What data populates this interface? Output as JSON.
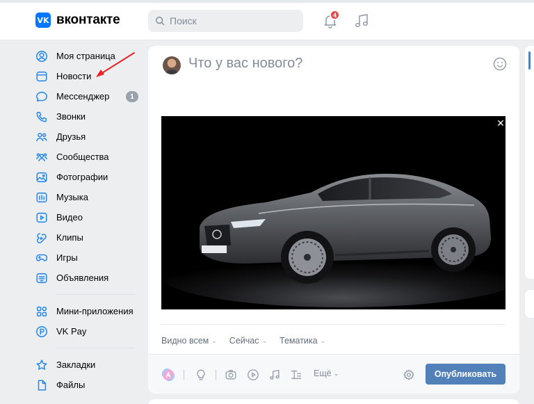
{
  "header": {
    "logo_mark": "VK",
    "logo_text": "вконтакте",
    "search_placeholder": "Поиск",
    "notifications_count": "4",
    "colors": {
      "brand": "#0077ff",
      "badge": "#e64646"
    }
  },
  "sidebar": {
    "items": [
      {
        "label": "Моя страница",
        "icon": "user-circle-icon"
      },
      {
        "label": "Новости",
        "icon": "news-icon"
      },
      {
        "label": "Мессенджер",
        "icon": "message-icon",
        "badge": "1"
      },
      {
        "label": "Звонки",
        "icon": "phone-icon"
      },
      {
        "label": "Друзья",
        "icon": "friends-icon"
      },
      {
        "label": "Сообщества",
        "icon": "communities-icon"
      },
      {
        "label": "Фотографии",
        "icon": "photo-icon"
      },
      {
        "label": "Музыка",
        "icon": "music-icon"
      },
      {
        "label": "Видео",
        "icon": "video-icon"
      },
      {
        "label": "Клипы",
        "icon": "clips-icon"
      },
      {
        "label": "Игры",
        "icon": "gamepad-icon"
      },
      {
        "label": "Объявления",
        "icon": "ads-icon"
      }
    ],
    "items2": [
      {
        "label": "Мини-приложения",
        "icon": "apps-icon"
      },
      {
        "label": "VK Pay",
        "icon": "vkpay-icon"
      }
    ],
    "items3": [
      {
        "label": "Закладки",
        "icon": "star-icon"
      },
      {
        "label": "Файлы",
        "icon": "file-icon"
      }
    ]
  },
  "composer": {
    "placeholder": "Что у вас нового?",
    "attachment": "car-photo",
    "close_glyph": "✕",
    "meta": [
      {
        "label": "Видно всем"
      },
      {
        "label": "Сейчас"
      },
      {
        "label": "Тематика"
      }
    ],
    "more_label": "Ещё",
    "publish_label": "Опубликовать",
    "colors": {
      "publish": "#5181b8"
    }
  }
}
